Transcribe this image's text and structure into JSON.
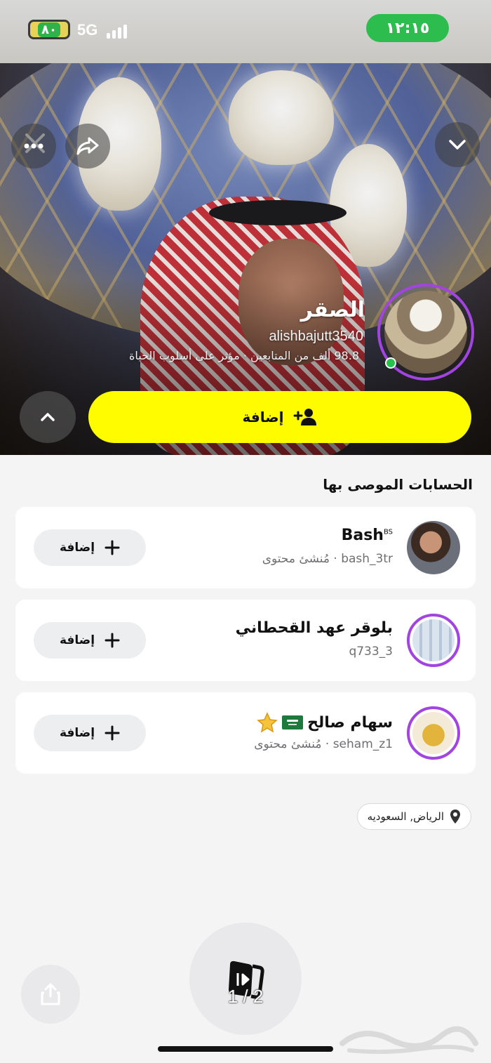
{
  "status_bar": {
    "battery": "٨٠",
    "network": "5G",
    "time": "١٢:١٥"
  },
  "profile": {
    "name": "الصقر",
    "username": "alishbajutt3540",
    "meta": "98.8 ألف من المتابعين · مؤثر على أسلوب الحياة",
    "add_label": "إضافة"
  },
  "recommended": {
    "title": "الحسابات الموصى بها",
    "items": [
      {
        "name": "Bash",
        "badge": "BS",
        "subtitle": "bash_3tr · مُنشئ محتوى",
        "add_label": "إضافة"
      },
      {
        "name": "بلوقر عهد القحطاني",
        "subtitle": "q733_3",
        "add_label": "إضافة"
      },
      {
        "name": "سهام صالح",
        "subtitle": "seham_z1 · مُنشئ محتوى",
        "add_label": "إضافة"
      }
    ]
  },
  "location": "الرياض, السعوديه",
  "bottom": {
    "page_indicator": "1 / 2"
  },
  "colors": {
    "accent_yellow": "#fffc00",
    "story_ring": "#a144e0",
    "online": "#27c24c"
  },
  "icons": [
    "close-icon",
    "more-icon",
    "share-icon",
    "chevron-down-icon",
    "chevron-up-icon",
    "add-friend-icon",
    "plus-icon",
    "location-pin-icon",
    "stories-icon",
    "saudi-flag-icon",
    "star-icon"
  ]
}
